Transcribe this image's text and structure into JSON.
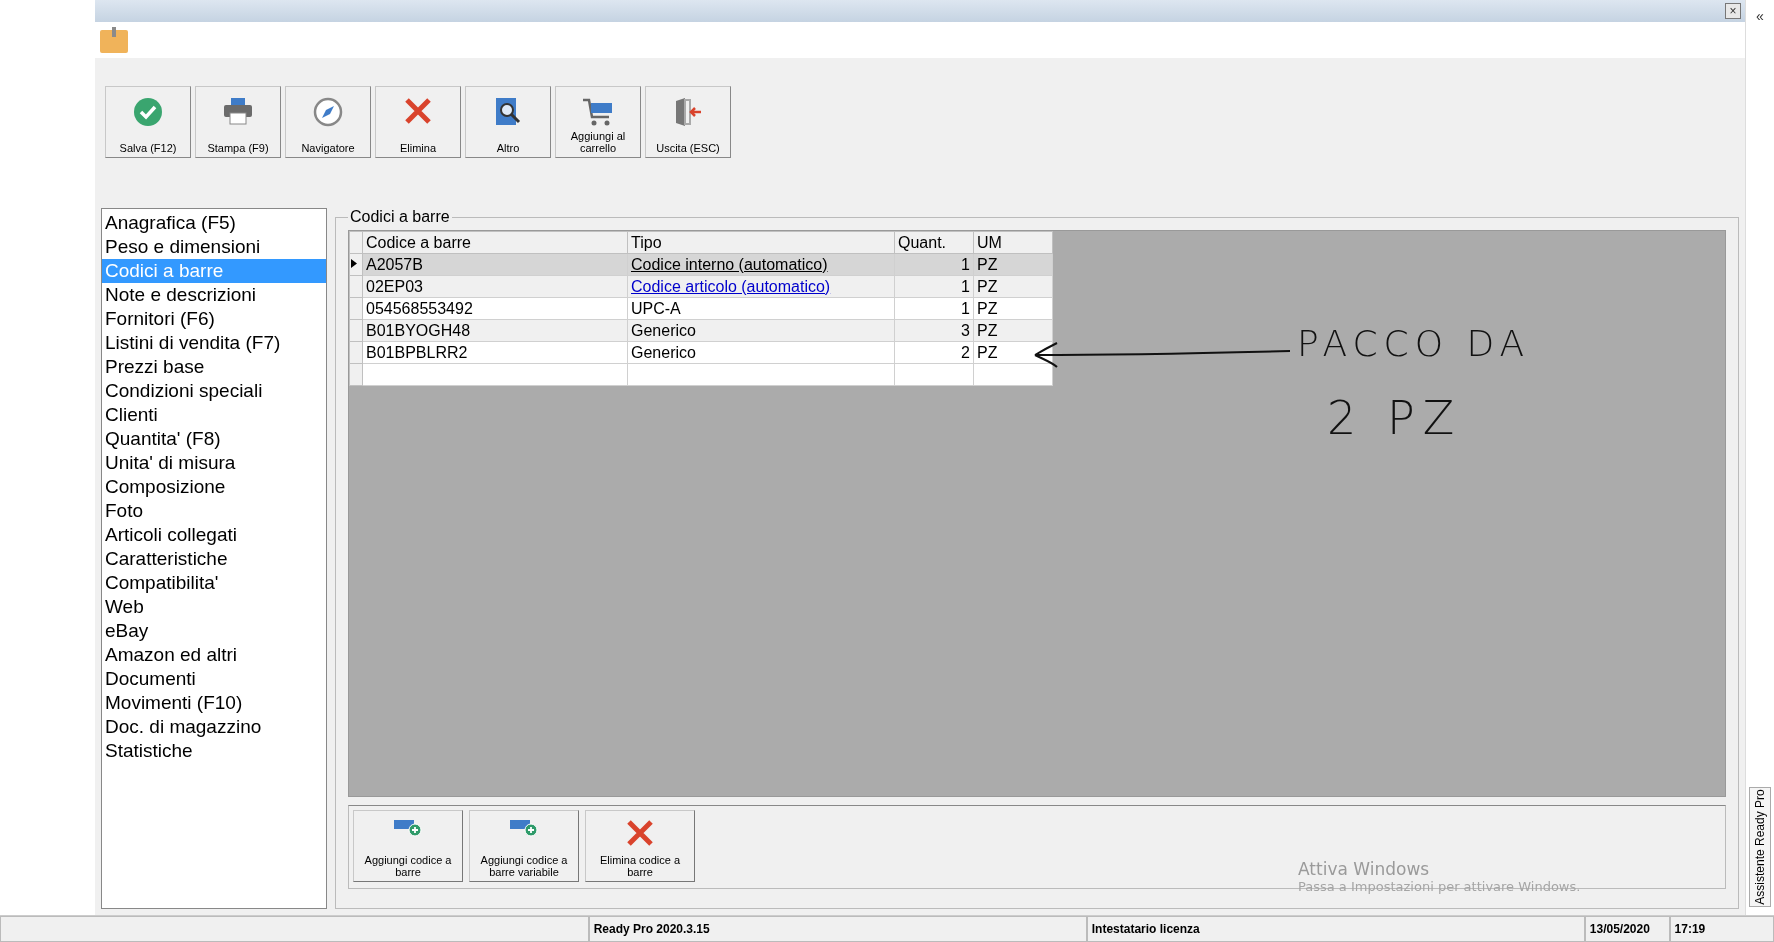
{
  "window": {
    "close": "×",
    "collapse": "«"
  },
  "toolbar": [
    {
      "label": "Salva (F12)",
      "kind": "check"
    },
    {
      "label": "Stampa (F9)",
      "kind": "printer"
    },
    {
      "label": "Navigatore",
      "kind": "compass"
    },
    {
      "label": "Elimina",
      "kind": "cross"
    },
    {
      "label": "Altro",
      "kind": "search"
    },
    {
      "label": "Aggiungi al carrello",
      "kind": "cart"
    },
    {
      "label": "Uscita (ESC)",
      "kind": "exit"
    }
  ],
  "sidebar": {
    "items": [
      {
        "label": "Anagrafica (F5)",
        "selected": false
      },
      {
        "label": "Peso e dimensioni",
        "selected": false
      },
      {
        "label": "Codici a barre",
        "selected": true
      },
      {
        "label": "Note e descrizioni",
        "selected": false
      },
      {
        "label": "Fornitori (F6)",
        "selected": false
      },
      {
        "label": "Listini di vendita (F7)",
        "selected": false
      },
      {
        "label": "Prezzi base",
        "selected": false
      },
      {
        "label": "Condizioni speciali",
        "selected": false
      },
      {
        "label": "Clienti",
        "selected": false
      },
      {
        "label": "Quantita' (F8)",
        "selected": false
      },
      {
        "label": "Unita' di misura",
        "selected": false
      },
      {
        "label": "Composizione",
        "selected": false
      },
      {
        "label": "Foto",
        "selected": false
      },
      {
        "label": "Articoli collegati",
        "selected": false
      },
      {
        "label": "Caratteristiche",
        "selected": false
      },
      {
        "label": "Compatibilita'",
        "selected": false
      },
      {
        "label": "Web",
        "selected": false
      },
      {
        "label": "eBay",
        "selected": false
      },
      {
        "label": "Amazon ed altri",
        "selected": false
      },
      {
        "label": "Documenti",
        "selected": false
      },
      {
        "label": "Movimenti (F10)",
        "selected": false
      },
      {
        "label": "Doc. di magazzino",
        "selected": false
      },
      {
        "label": "Statistiche",
        "selected": false
      }
    ]
  },
  "group": {
    "title": "Codici a barre"
  },
  "table": {
    "columns": [
      "Codice a barre",
      "Tipo",
      "Quant.",
      "UM"
    ],
    "rows": [
      {
        "barcode": "A2057B",
        "type": "Codice interno (automatico)",
        "underlined": true,
        "link": false,
        "qty": "1",
        "um": "PZ",
        "selected": true
      },
      {
        "barcode": "02EP03",
        "type": "Codice articolo (automatico)",
        "underlined": true,
        "link": true,
        "qty": "1",
        "um": "PZ",
        "selected": false
      },
      {
        "barcode": "054568553492",
        "type": "UPC-A",
        "underlined": false,
        "link": false,
        "qty": "1",
        "um": "PZ",
        "selected": false
      },
      {
        "barcode": "B01BYOGH48",
        "type": "Generico",
        "underlined": false,
        "link": false,
        "qty": "3",
        "um": "PZ",
        "selected": false
      },
      {
        "barcode": "B01BPBLRR2",
        "type": "Generico",
        "underlined": false,
        "link": false,
        "qty": "2",
        "um": "PZ",
        "selected": false
      }
    ]
  },
  "annotation": {
    "lines": [
      "PACCO DA",
      "2 PZ"
    ]
  },
  "actions": [
    {
      "label": "Aggiungi codice a barre",
      "kind": "add"
    },
    {
      "label": "Aggiungi codice a barre variabile",
      "kind": "add"
    },
    {
      "label": "Elimina codice a barre",
      "kind": "cross"
    }
  ],
  "watermark": {
    "title": "Attiva Windows",
    "text": "Passa a Impostazioni per attivare Windows."
  },
  "side_tab": "Assistente Ready Pro",
  "status_bar": [
    "Ready Pro 2020.3.15",
    "Intestatario licenza",
    "13/05/2020",
    "17:19"
  ]
}
